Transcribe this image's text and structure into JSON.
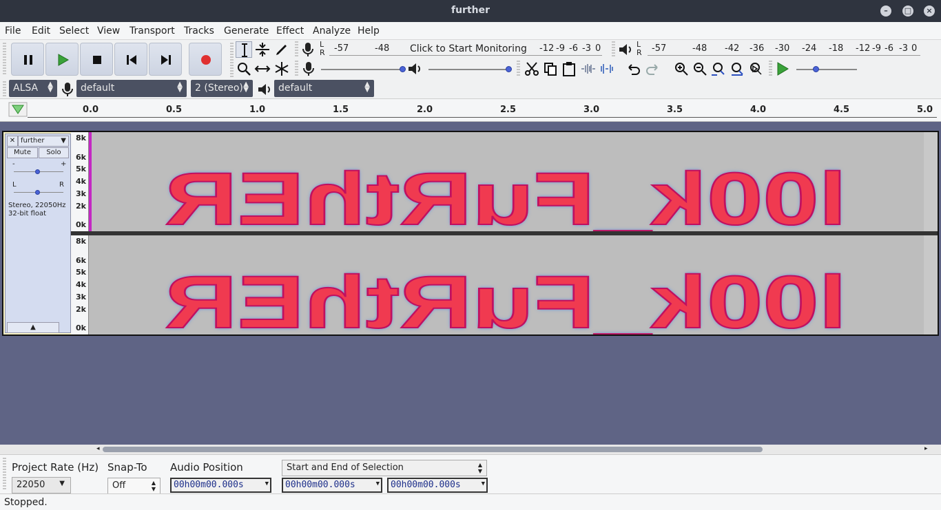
{
  "window": {
    "title": "further"
  },
  "menu": [
    "File",
    "Edit",
    "Select",
    "View",
    "Transport",
    "Tracks",
    "Generate",
    "Effect",
    "Analyze",
    "Help"
  ],
  "meters": {
    "record_ticks": [
      "-57",
      "-48",
      "-12",
      "-9",
      "-6",
      "-3",
      "0"
    ],
    "record_prompt": "Click to Start Monitoring",
    "playback_ticks": [
      "-57",
      "-48",
      "-42",
      "-36",
      "-30",
      "-24",
      "-18",
      "-12",
      "-9",
      "-6",
      "-3",
      "0"
    ],
    "lr": [
      "L",
      "R"
    ]
  },
  "devices": {
    "host": "ALSA",
    "recording_device": "default",
    "channels": "2 (Stereo)",
    "playback_device": "default"
  },
  "ruler": {
    "ticks": [
      "0.0",
      "0.5",
      "1.0",
      "1.5",
      "2.0",
      "2.5",
      "3.0",
      "3.5",
      "4.0",
      "4.5",
      "5.0"
    ]
  },
  "track": {
    "name": "further",
    "mute_label": "Mute",
    "solo_label": "Solo",
    "gain_minus": "-",
    "gain_plus": "+",
    "pan_left": "L",
    "pan_right": "R",
    "info_line1": "Stereo, 22050Hz",
    "info_line2": "32-bit float",
    "freq_labels": [
      "8k",
      "6k",
      "5k",
      "4k",
      "3k",
      "2k",
      "0k"
    ],
    "spectrogram_text": "l00k_FuRthER"
  },
  "selection_bar": {
    "project_rate_label": "Project Rate (Hz)",
    "project_rate": "22050",
    "snap_to_label": "Snap-To",
    "snap_to": "Off",
    "audio_position_label": "Audio Position",
    "selection_mode": "Start and End of Selection",
    "audio_position": "00h00m00.000s",
    "selection_start": "00h00m00.000s",
    "selection_end": "00h00m00.000s"
  },
  "status": "Stopped.",
  "colors": {
    "accent": "#4a63d6",
    "record": "#e03030",
    "play": "#3aa23a",
    "spec_hot": "#f03a50"
  }
}
